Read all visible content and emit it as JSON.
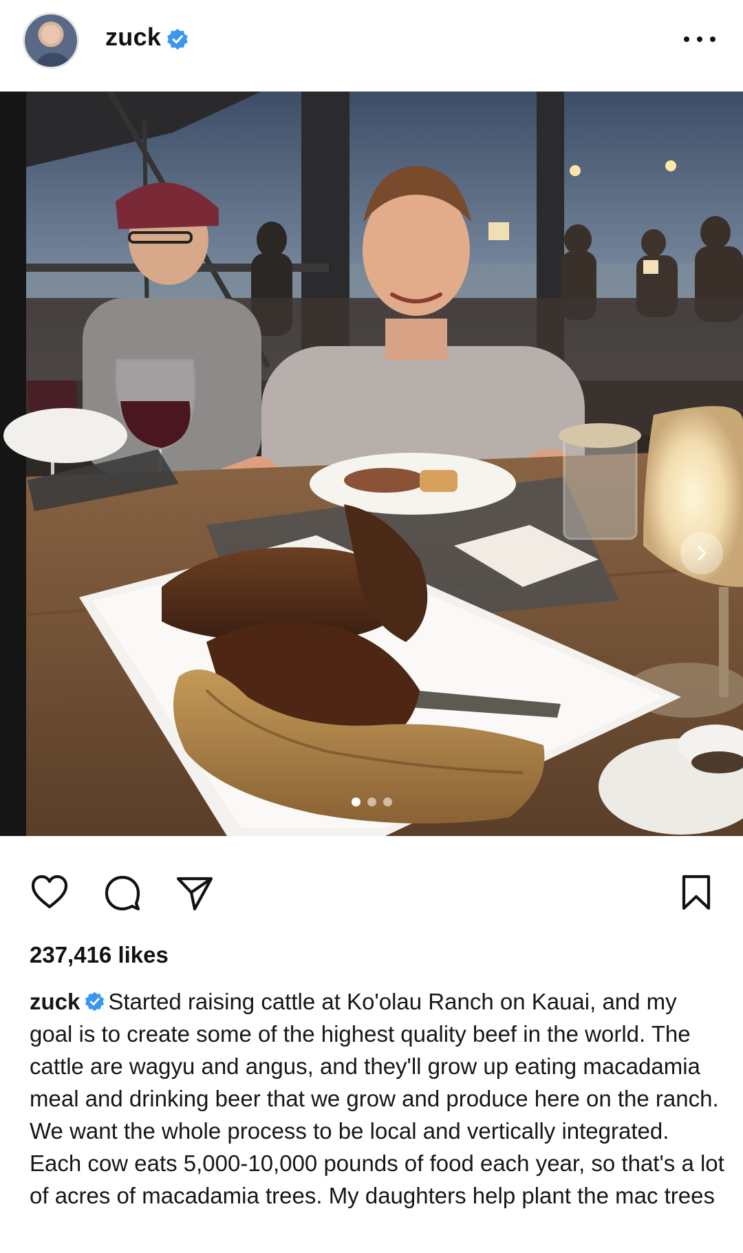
{
  "header": {
    "username": "zuck",
    "verified": true,
    "more_icon": "more-horizontal-icon"
  },
  "photo": {
    "carousel": {
      "total": 3,
      "current": 1
    },
    "next_icon": "chevron-right-icon"
  },
  "actions": {
    "like_icon": "heart-icon",
    "comment_icon": "comment-icon",
    "share_icon": "send-icon",
    "save_icon": "bookmark-icon"
  },
  "likes": "237,416 likes",
  "caption": {
    "username": "zuck",
    "text": "Started raising cattle at Ko'olau Ranch on Kauai, and my goal is to create some of the highest quality beef in the world. The cattle are wagyu and angus, and they'll grow up eating macadamia meal and drinking beer that we grow and produce here on the ranch. We want the whole process to be local and vertically integrated. Each cow eats 5,000-10,000 pounds of food each year, so that's a lot of acres of macadamia trees. My daughters help plant the mac trees"
  },
  "colors": {
    "verified": "#3897f0",
    "text": "#111111",
    "background": "#ffffff"
  }
}
